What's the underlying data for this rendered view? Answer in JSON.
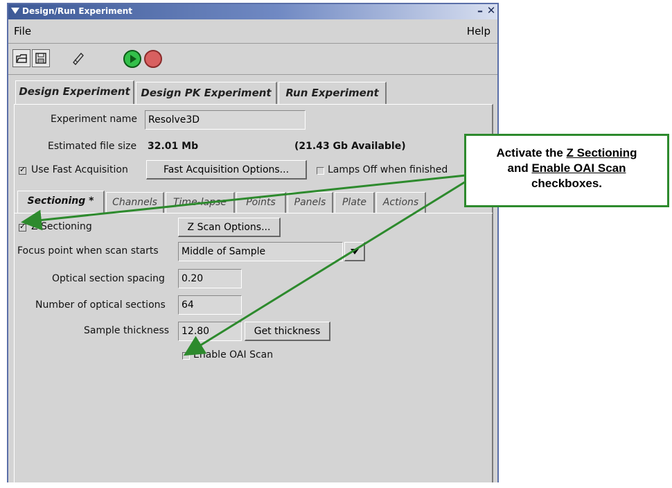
{
  "window": {
    "title": "Design/Run Experiment"
  },
  "menu": {
    "file": "File",
    "help": "Help"
  },
  "toolbar": {
    "icons": [
      "open-icon",
      "save-icon",
      "edit-icon",
      "run-icon",
      "stop-icon"
    ]
  },
  "tabs": [
    "Design Experiment",
    "Design PK Experiment",
    "Run Experiment"
  ],
  "design": {
    "experiment_name_label": "Experiment name",
    "experiment_name_value": "Resolve3D",
    "file_size_label": "Estimated file size",
    "file_size_value": "32.01 Mb",
    "available": "(21.43 Gb Available)",
    "fast_acq_label": "Use Fast Acquisition",
    "fast_acq_options": "Fast Acquisition Options...",
    "lamps_off_label": "Lamps Off when finished"
  },
  "subtabs": [
    "Sectioning *",
    "Channels",
    "Time-lapse",
    "Points",
    "Panels",
    "Plate",
    "Actions"
  ],
  "sectioning": {
    "z_label": "Z Sectioning",
    "z_scan_options": "Z Scan Options...",
    "focus_label": "Focus point when scan starts",
    "focus_value": "Middle of Sample",
    "spacing_label": "Optical section spacing",
    "spacing_value": "0.20",
    "number_label": "Number of optical sections",
    "number_value": "64",
    "thickness_label": "Sample thickness",
    "thickness_value": "12.80",
    "get_thickness": "Get thickness",
    "oai_label": "Enable OAI Scan"
  },
  "callout": {
    "line1_pre": "Activate the ",
    "line1_link": "Z Sectioning",
    "line2_pre": "and ",
    "line2_link": "Enable OAI Scan",
    "line3": "checkboxes."
  },
  "colors": {
    "callout_green": "#2d8a2d",
    "title_blue": "#3e5a97"
  }
}
